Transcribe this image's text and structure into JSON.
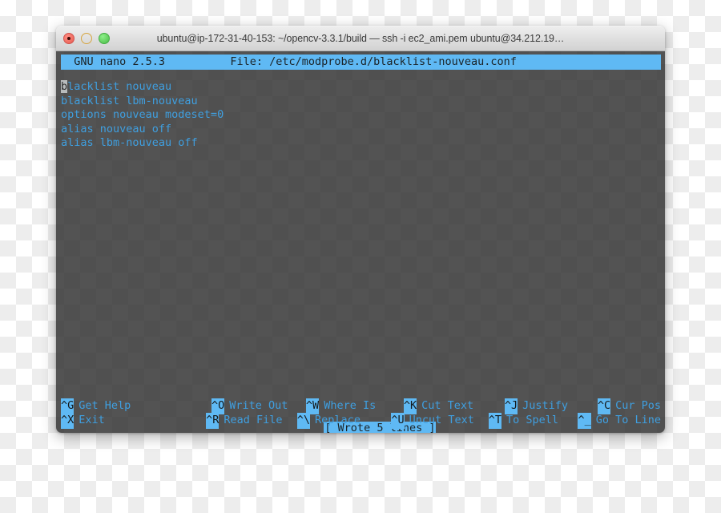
{
  "window": {
    "title": "ubuntu@ip-172-31-40-153: ~/opencv-3.3.1/build — ssh -i ec2_ami.pem ubuntu@34.212.19…",
    "traffic_lights": [
      {
        "name": "close",
        "color": "#ee6b60"
      },
      {
        "name": "minimize",
        "color": "#f1bf4d"
      },
      {
        "name": "maximize",
        "color": "#5ecb5a"
      }
    ]
  },
  "nano": {
    "header": "  GNU nano 2.5.3          File: /etc/modprobe.d/blacklist-nouveau.conf",
    "version_label": "GNU nano 2.5.3",
    "file_label": "File: /etc/modprobe.d/blacklist-nouveau.conf",
    "cursor_char": "b",
    "lines": [
      "lacklist nouveau",
      "blacklist lbm-nouveau",
      "options nouveau modeset=0",
      "alias nouveau off",
      "alias lbm-nouveau off"
    ],
    "status_message": "[ Wrote 5 lines ]",
    "shortcuts_row1": [
      {
        "key": "^G",
        "label": "Get Help"
      },
      {
        "key": "^O",
        "label": "Write Out"
      },
      {
        "key": "^W",
        "label": "Where Is"
      },
      {
        "key": "^K",
        "label": "Cut Text"
      },
      {
        "key": "^J",
        "label": "Justify"
      },
      {
        "key": "^C",
        "label": "Cur Pos"
      }
    ],
    "shortcuts_row2": [
      {
        "key": "^X",
        "label": "Exit"
      },
      {
        "key": "^R",
        "label": "Read File"
      },
      {
        "key": "^\\",
        "label": "Replace"
      },
      {
        "key": "^U",
        "label": "Uncut Text"
      },
      {
        "key": "^T",
        "label": "To Spell"
      },
      {
        "key": "^_",
        "label": "Go To Line"
      }
    ]
  },
  "colors": {
    "accent_blue": "#5fb9f4",
    "text_blue": "#3f9fe0",
    "terminal_bg": "#282828",
    "titlebar_bg": "#dfdfdf"
  }
}
